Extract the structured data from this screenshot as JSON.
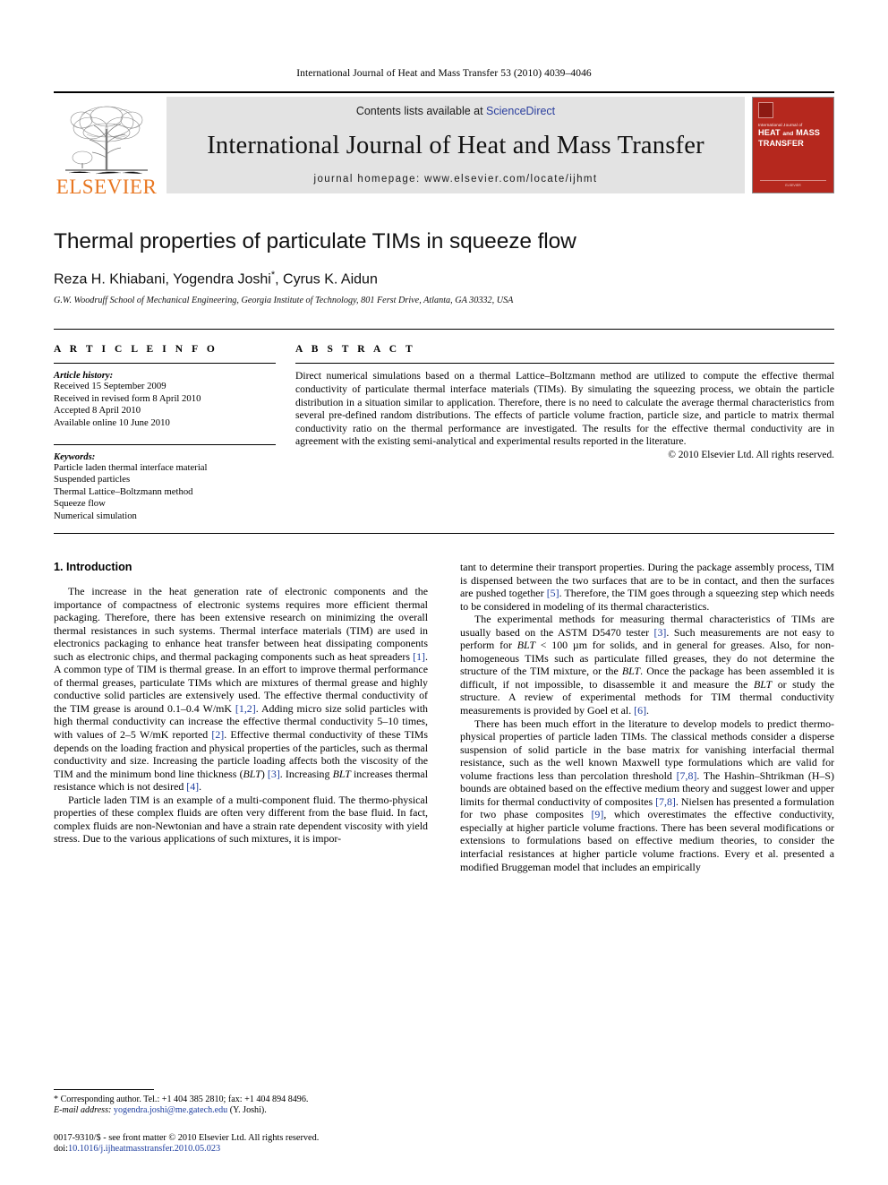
{
  "running_head": "International Journal of Heat and Mass Transfer 53 (2010) 4039–4046",
  "masthead": {
    "publisher": "ELSEVIER",
    "contents_prefix": "Contents lists available at ",
    "contents_link": "ScienceDirect",
    "journal_title": "International Journal of Heat and Mass Transfer",
    "homepage": "journal homepage: www.elsevier.com/locate/ijhmt",
    "cover": {
      "small_line": "International Journal of",
      "title_line1": "HEAT",
      "title_and": "and",
      "title_line1b": "MASS",
      "title_line2": "TRANSFER",
      "footer": "ELSEVIER",
      "color": "#b5281e"
    }
  },
  "article": {
    "title": "Thermal properties of particulate TIMs in squeeze flow",
    "authors": "Reza H. Khiabani, Yogendra Joshi",
    "corresponding_mark": "*",
    "authors_tail": ", Cyrus K. Aidun",
    "affiliation": "G.W. Woodruff School of Mechanical Engineering, Georgia Institute of Technology, 801 Ferst Drive, Atlanta, GA 30332, USA"
  },
  "info": {
    "label": "A R T I C L E   I N F O",
    "history_head": "Article history:",
    "history": [
      "Received 15 September 2009",
      "Received in revised form 8 April 2010",
      "Accepted 8 April 2010",
      "Available online 10 June 2010"
    ],
    "keywords_head": "Keywords:",
    "keywords": [
      "Particle laden thermal interface material",
      "Suspended particles",
      "Thermal Lattice–Boltzmann method",
      "Squeeze flow",
      "Numerical simulation"
    ]
  },
  "abstract": {
    "label": "A B S T R A C T",
    "text": "Direct numerical simulations based on a thermal Lattice–Boltzmann method are utilized to compute the effective thermal conductivity of particulate thermal interface materials (TIMs). By simulating the squeezing process, we obtain the particle distribution in a situation similar to application. Therefore, there is no need to calculate the average thermal characteristics from several pre-defined random distributions. The effects of particle volume fraction, particle size, and particle to matrix thermal conductivity ratio on the thermal performance are investigated. The results for the effective thermal conductivity are in agreement with the existing semi-analytical and experimental results reported in the literature.",
    "copyright": "© 2010 Elsevier Ltd. All rights reserved."
  },
  "section": {
    "heading": "1. Introduction"
  },
  "footnote": {
    "corresponding": "* Corresponding author. Tel.: +1 404 385 2810; fax: +1 404 894 8496.",
    "email_label": "E-mail address:",
    "email": "yogendra.joshi@me.gatech.edu",
    "email_owner": "(Y. Joshi).",
    "issn": "0017-9310/$ - see front matter © 2010 Elsevier Ltd. All rights reserved.",
    "doi_label": "doi:",
    "doi": "10.1016/j.ijheatmasstransfer.2010.05.023"
  }
}
